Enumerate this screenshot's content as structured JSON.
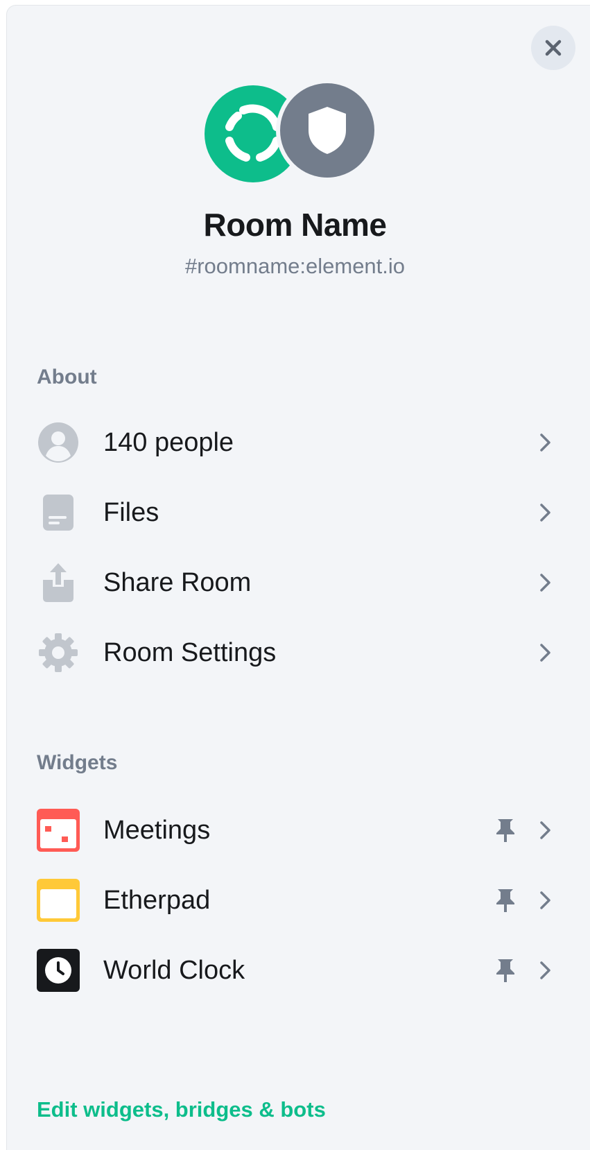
{
  "header": {
    "room_name": "Room Name",
    "room_alias": "#roomname:element.io",
    "close_icon": "close-icon",
    "avatars": [
      "element-logo-avatar",
      "shield-avatar"
    ]
  },
  "about": {
    "heading": "About",
    "items": [
      {
        "label": "140 people",
        "icon": "person-icon"
      },
      {
        "label": "Files",
        "icon": "file-icon"
      },
      {
        "label": "Share Room",
        "icon": "share-icon"
      },
      {
        "label": "Room Settings",
        "icon": "gear-icon"
      }
    ]
  },
  "widgets": {
    "heading": "Widgets",
    "items": [
      {
        "label": "Meetings",
        "icon": "meetings-icon",
        "color": "#ff5b55"
      },
      {
        "label": "Etherpad",
        "icon": "etherpad-icon",
        "color": "#ffc938"
      },
      {
        "label": "World Clock",
        "icon": "clock-icon",
        "color": "#17191c"
      }
    ],
    "edit_link": "Edit widgets, bridges & bots"
  },
  "colors": {
    "accent": "#0dbd8b",
    "panel_bg": "#f3f5f8",
    "secondary_text": "#737d8c",
    "icon_grey": "#c1c6cd"
  }
}
